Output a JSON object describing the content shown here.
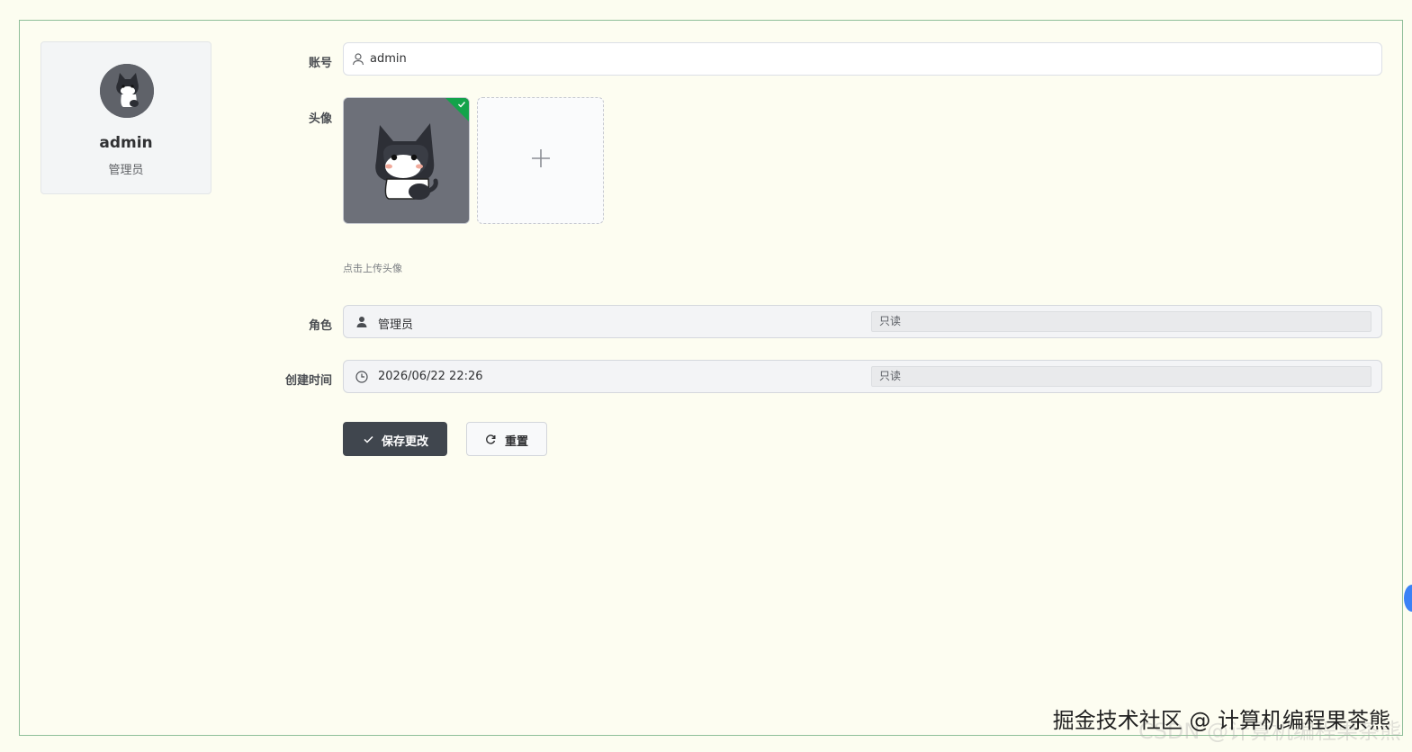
{
  "profile": {
    "name": "admin",
    "role": "管理员"
  },
  "form": {
    "account_label": "账号",
    "account_value": "admin",
    "avatar_label": "头像",
    "upload_hint": "点击上传头像",
    "role_label": "角色",
    "role_value": "管理员",
    "role_readonly": "只读",
    "created_label": "创建时间",
    "created_value": "2026/06/22 22:26",
    "created_readonly": "只读"
  },
  "buttons": {
    "save": "保存更改",
    "reset": "重置"
  },
  "watermark": {
    "text": "掘金技术社区 @ 计算机编程果茶熊",
    "text_shadow": "CSDN @计算机编程果茶熊"
  },
  "colors": {
    "primary_button": "#40464e",
    "success": "#13a34a",
    "page_background": "#fcfdf0"
  }
}
